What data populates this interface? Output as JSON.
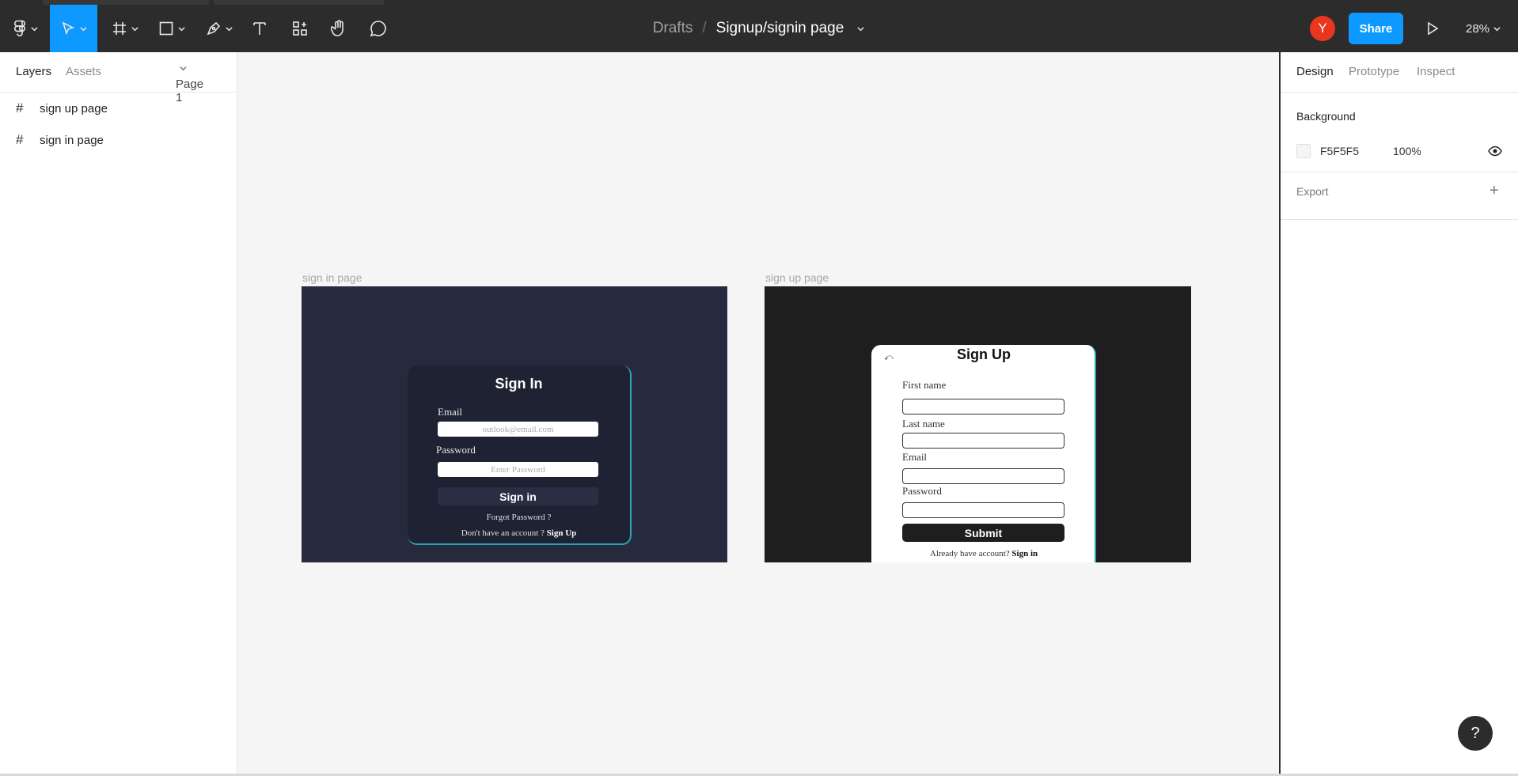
{
  "toolbar": {
    "breadcrumb_root": "Drafts",
    "breadcrumb_sep": "/",
    "file_name": "Signup/signin page",
    "avatar_initial": "Y",
    "share_label": "Share",
    "zoom_level": "28%",
    "tools": [
      "figma-menu-icon",
      "move-tool-icon",
      "frame-tool-icon",
      "rectangle-tool-icon",
      "pen-tool-icon",
      "text-tool-icon",
      "resources-icon",
      "hand-tool-icon",
      "comment-tool-icon"
    ]
  },
  "left_panel": {
    "tabs": {
      "layers": "Layers",
      "assets": "Assets"
    },
    "page_selector": "Page 1",
    "layers": [
      {
        "label": "sign up page"
      },
      {
        "label": "sign in page"
      }
    ]
  },
  "canvas": {
    "signin_frame_label": "sign in page",
    "signup_frame_label": "sign up page",
    "signin": {
      "title": "Sign In",
      "email_label": "Email",
      "email_placeholder": "outlook@email.com",
      "password_label": "Password",
      "password_placeholder": "Enter Password",
      "button": "Sign in",
      "forgot": "Forgot Password ?",
      "no_account": "Don't have an account ?",
      "signup_link": "Sign Up"
    },
    "signup": {
      "title": "Sign Up",
      "first_name_label": "First name",
      "last_name_label": "Last name",
      "email_label": "Email",
      "password_label": "Password",
      "button": "Submit",
      "have_account": "Already have account?",
      "signin_link": "Sign in"
    }
  },
  "right_panel": {
    "tabs": {
      "design": "Design",
      "prototype": "Prototype",
      "inspect": "Inspect"
    },
    "background_title": "Background",
    "background_hex": "F5F5F5",
    "background_opacity": "100%",
    "export_title": "Export"
  },
  "help_label": "?",
  "colors": {
    "accent": "#0d99ff",
    "toolbar_bg": "#2c2c2c",
    "avatar": "#e8361f",
    "canvas_bg": "#F5F5F5"
  }
}
